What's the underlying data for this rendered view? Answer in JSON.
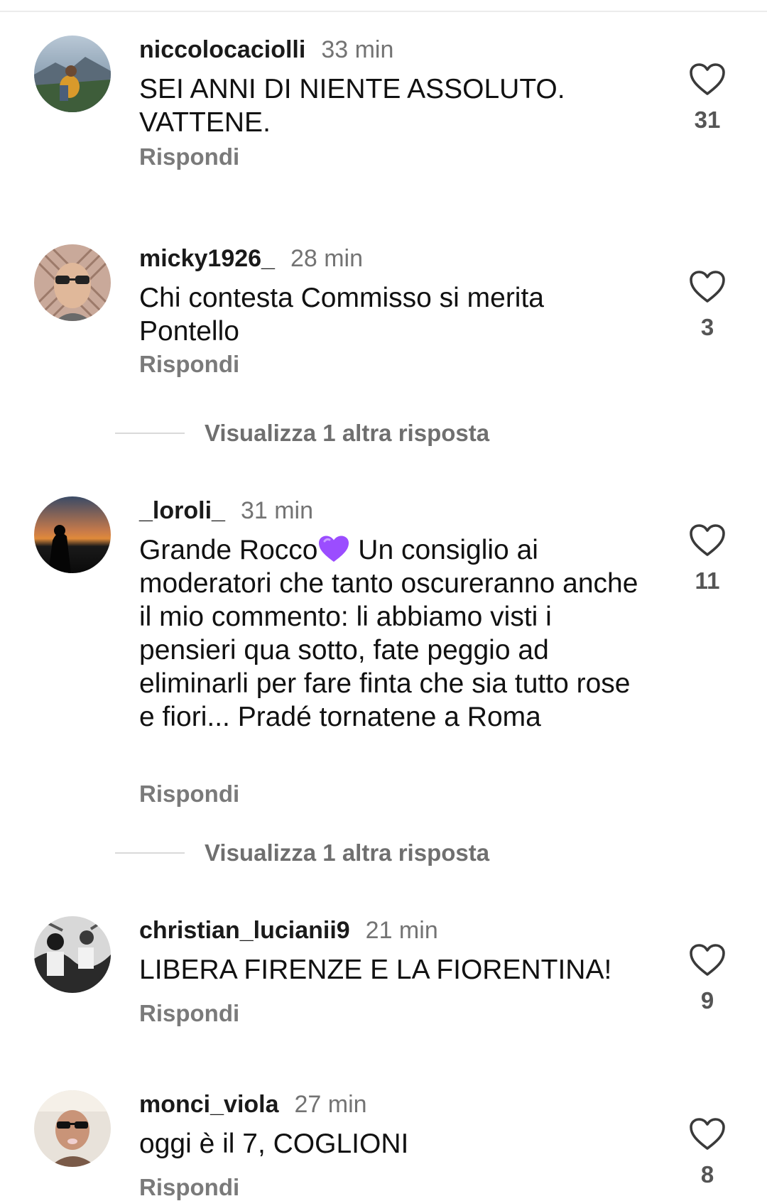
{
  "comments": [
    {
      "username": "niccolocaciolli",
      "time": "33 min",
      "text": "SEI ANNI DI NIENTE ASSOLUTO. VATTENE.",
      "likes": "31",
      "reply_label": "Rispondi"
    },
    {
      "username": "micky1926_",
      "time": "28 min",
      "text": "Chi contesta Commisso si merita Pontello",
      "likes": "3",
      "reply_label": "Rispondi",
      "view_replies": "Visualizza 1 altra risposta"
    },
    {
      "username": "_loroli_",
      "time": "31 min",
      "text_before_emoji": "Grande Rocco",
      "text_after_emoji": " Un consiglio ai moderatori che tanto oscureranno anche il mio commento: li abbiamo visti i pensieri qua sotto, fate peggio ad eliminarli per fare finta che sia tutto rose e fiori... Pradé tornatene a Roma",
      "emoji": "purple-heart-icon",
      "likes": "11",
      "reply_label": "Rispondi",
      "view_replies": "Visualizza 1 altra risposta"
    },
    {
      "username": "christian_lucianii9",
      "time": "21 min",
      "text": "LIBERA FIRENZE E LA FIORENTINA!",
      "likes": "9",
      "reply_label": "Rispondi"
    },
    {
      "username": "monci_viola",
      "time": "27 min",
      "text": "oggi è il 7, COGLIONI",
      "likes": "8",
      "reply_label": "Rispondi"
    }
  ],
  "icons": {
    "like": "heart-outline-icon"
  },
  "colors": {
    "username": "#1a1a1a",
    "meta": "#737373",
    "reply": "#7a7a7a",
    "emoji_heart": "#9b4dff"
  }
}
